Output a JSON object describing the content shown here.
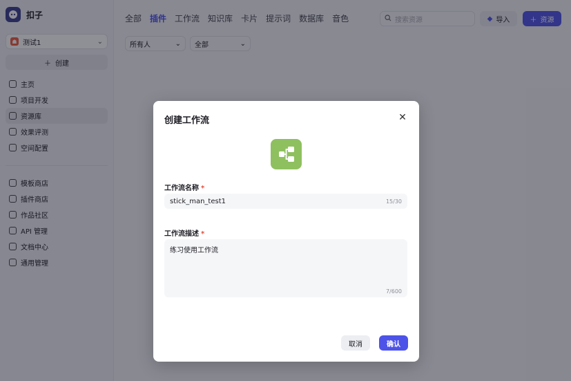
{
  "brand": {
    "name": "扣子",
    "logo_icon": "coze-logo-icon"
  },
  "workspace": {
    "name": "测试1",
    "avatar_text": "☗"
  },
  "sidebar": {
    "create_label": "创建",
    "items": [
      {
        "label": "主页",
        "icon": "home-icon"
      },
      {
        "label": "项目开发",
        "icon": "gamepad-icon"
      },
      {
        "label": "资源库",
        "icon": "library-icon",
        "active": true
      },
      {
        "label": "效果评测",
        "icon": "evaluation-icon"
      },
      {
        "label": "空间配置",
        "icon": "space-settings-icon"
      },
      {
        "label": "模板商店",
        "icon": "template-icon"
      },
      {
        "label": "插件商店",
        "icon": "plugin-icon"
      },
      {
        "label": "作品社区",
        "icon": "community-icon"
      },
      {
        "label": "API 管理",
        "icon": "api-icon"
      },
      {
        "label": "文档中心",
        "icon": "docs-icon"
      },
      {
        "label": "通用管理",
        "icon": "admin-icon"
      }
    ]
  },
  "header": {
    "tabs": [
      "全部",
      "插件",
      "工作流",
      "知识库",
      "卡片",
      "提示词",
      "数据库",
      "音色"
    ],
    "active_tab": "插件",
    "search_placeholder": "搜索资源",
    "import_label": "导入",
    "resource_label": "资源"
  },
  "filters": {
    "owner": "所有人",
    "type": "全部"
  },
  "modal": {
    "title": "创建工作流",
    "name_label": "工作流名称",
    "name_value": "stick_man_test1",
    "name_counter": "15/30",
    "desc_label": "工作流描述",
    "desc_value": "练习使用工作流",
    "desc_counter": "7/600",
    "required_mark": "*",
    "cancel_label": "取消",
    "confirm_label": "确认",
    "icon": "workflow-icon"
  },
  "colors": {
    "accent": "#4d53e8",
    "workflow_icon_bg": "#8ec05f",
    "required": "#e34d3b"
  }
}
